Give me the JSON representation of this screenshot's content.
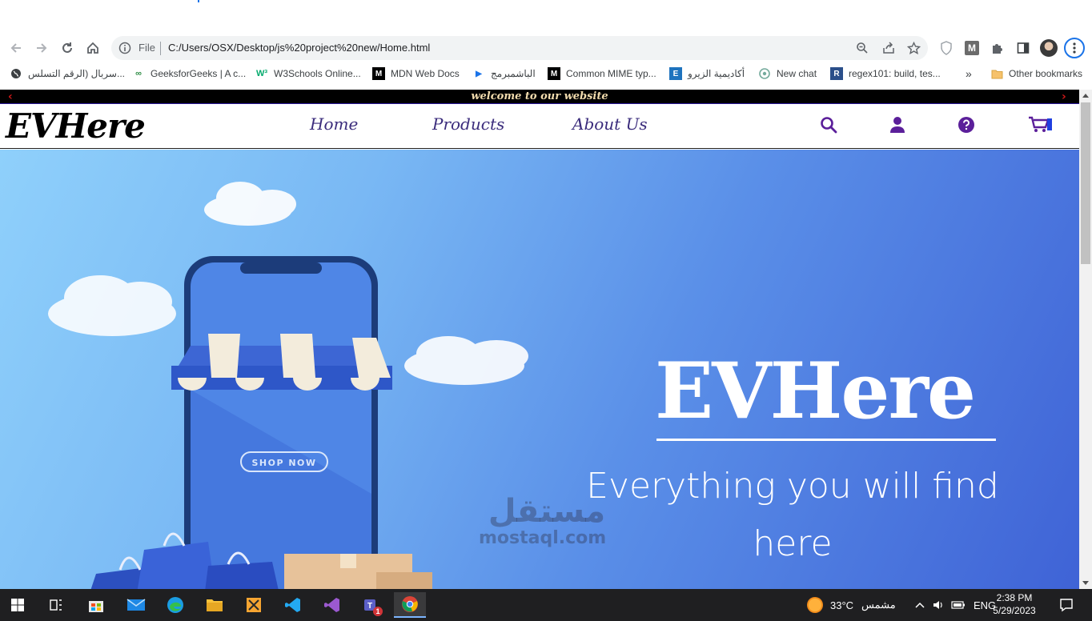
{
  "browser": {
    "scheme": "File",
    "url": "C:/Users/OSX/Desktop/js%20project%20new/Home.html"
  },
  "bookmarks": [
    {
      "label": "سربال (الرقم التسلس...",
      "icon": "globe-icon"
    },
    {
      "label": "GeeksforGeeks | A c...",
      "icon": "gfg-icon"
    },
    {
      "label": "W3Schools Online...",
      "icon": "w3-icon"
    },
    {
      "label": "MDN Web Docs",
      "icon": "mdn-icon"
    },
    {
      "label": "الباشمبرمج",
      "icon": "bashmohandes-icon"
    },
    {
      "label": "Common MIME typ...",
      "icon": "mdn-icon"
    },
    {
      "label": "أكاديمية الزيرو",
      "icon": "e-icon"
    },
    {
      "label": "New chat",
      "icon": "chatgpt-icon"
    },
    {
      "label": "regex101: build, tes...",
      "icon": "r-icon"
    }
  ],
  "bookmarks_more": "»",
  "other_bookmarks": "Other bookmarks",
  "site": {
    "welcome": "welcome to our website",
    "logo": "EVHere",
    "nav": {
      "home": "Home",
      "products": "Products",
      "about": "About Us"
    },
    "hero": {
      "title": "EVHere",
      "subtitle_line1": "Everything you will find",
      "subtitle_line2": "here",
      "shop_now": "SHOP NOW"
    }
  },
  "watermark": {
    "arabic": "مستقل",
    "latin": "mostaql.com"
  },
  "taskbar": {
    "weather_temp": "33°C",
    "weather_label": "مشمس",
    "language": "ENG",
    "time": "2:38 PM",
    "date": "5/29/2023",
    "teams_badge": "1"
  },
  "colors": {
    "nav": "#3b2c7c",
    "accent": "#5b1f9a",
    "welcome_bg": "#000000",
    "welcome_text": "#f2dcae"
  }
}
